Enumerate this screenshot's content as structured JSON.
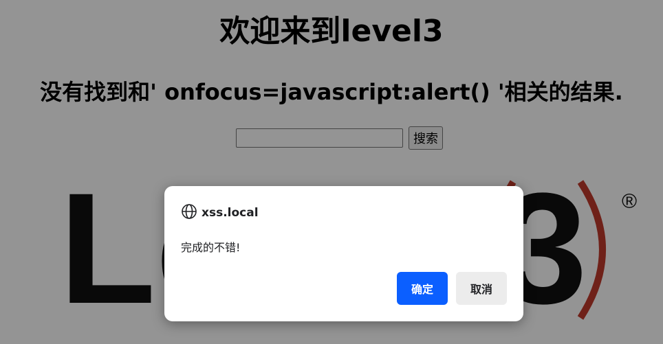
{
  "page": {
    "title": "欢迎来到level3",
    "result_message": "没有找到和' onfocus=javascript:alert() '相关的结果.",
    "search": {
      "value": "",
      "button_label": "搜索"
    },
    "logo": {
      "text_left": "Le",
      "text_right": "3",
      "registered_mark": "®"
    }
  },
  "dialog": {
    "origin": "xss.local",
    "origin_icon": "globe-icon",
    "message": "完成的不错!",
    "ok_label": "确定",
    "cancel_label": "取消"
  },
  "colors": {
    "overlay": "rgba(0,0,0,0.42)",
    "ok_button": "#0b5fff",
    "cancel_button": "#ececec",
    "logo_paren": "#c0392b"
  }
}
